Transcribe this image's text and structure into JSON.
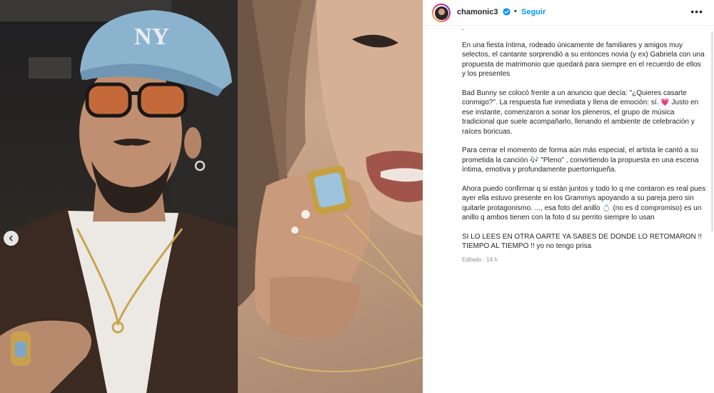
{
  "post": {
    "username": "chamonic3",
    "follow_label": "Seguir",
    "separator": "•",
    "more_icon": "more-icon",
    "verified_icon": "verified-icon",
    "accent_color": "#0095f6",
    "carousel_prev_icon": "chevron-left-icon"
  },
  "caption": {
    "leading_dot": ".",
    "paragraphs": [
      "En una fiesta íntima, rodeado únicamente de familiares y amigos muy selectos, el cantante sorprendió a su entonces novia (y ex) Gabriela con una propuesta de matrimonio que quedará para siempre en el recuerdo de ellos y los presentes",
      "Bad Bunny se colocó frente a un anuncio que decía: \"¿Quieres casarte conmigo?\". La respuesta fue inmediata y llena de emoción: sí. 💗 Justo en ese instante, comenzaron a sonar los pleneros, el grupo de música tradicional que suele acompañarlo, llenando el ambiente de celebración y raíces boricuas.",
      "Para cerrar el momento de forma aún más especial, el artista le cantó a su prometida la canción 🎶 \"Pleno\" , convirtiendo la propuesta en una escena íntima, emotiva y profundamente puertorriqueña.",
      "Ahora puedo confirmar q si están juntos y todo lo q me contaron es real pues ayer ella estuvo presente en los Grammys apoyando a su pareja pero sin quitarle protagonismo. ..., esa foto del anillo 💍 (no es d compromiso) es un anillo q ambos tienen con la foto d su perrito siempre lo usan",
      "SI LO LEES EN OTRA OARTE YA SABES DE DONDE LO RETOMARON !! TIEMPO AL TIEMPO !! yo no tengo prisa"
    ],
    "edited_label": "Editado",
    "separator": "·",
    "time_ago": "14 h"
  }
}
